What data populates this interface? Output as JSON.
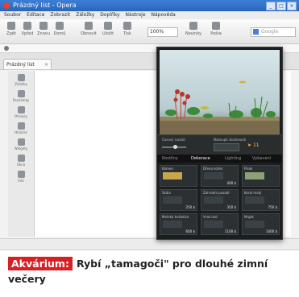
{
  "window": {
    "title": "Prázdný list - Opera"
  },
  "menu": [
    "Soubor",
    "Editace",
    "Zobrazit",
    "Záložky",
    "Doplňky",
    "Nástroje",
    "Nápověda"
  ],
  "toolbar": {
    "buttons": [
      "Zpět",
      "Vpřed",
      "Znovu",
      "Domů",
      "Obnovit",
      "Uložit",
      "Tisk"
    ],
    "zoom": "100%",
    "right_buttons": [
      "Novinky",
      "Pošta"
    ],
    "search_placeholder": "Google"
  },
  "tab": {
    "label": "Prázdný list"
  },
  "side_panel": [
    "Záložky",
    "Poznámky",
    "Přenosy",
    "Historie",
    "Widgety",
    "Okna",
    "Info"
  ],
  "aquarium_app": {
    "hud": {
      "label1": "Časový rozsah",
      "label2": "Nakoupit zkušenosti",
      "fish_count": "11"
    },
    "tabs": [
      "Rostliny",
      "Dekorace",
      "Lighting",
      "Vybavení"
    ],
    "active_tab": "Dekorace",
    "tiles": [
      {
        "name": "Kámen",
        "price": "",
        "color": "#c9a64b"
      },
      {
        "name": "Dřevo kořen",
        "price": "400 $",
        "color": "#3b4245"
      },
      {
        "name": "Písek",
        "price": "",
        "color": "#8da07a"
      },
      {
        "name": "Skála",
        "price": "250 $",
        "color": "#3b4245"
      },
      {
        "name": "Zahradní pozadí",
        "price": "350 $",
        "color": "#3b4245"
      },
      {
        "name": "Koral malý",
        "price": "750 $",
        "color": "#3b4245"
      },
      {
        "name": "Mořská hvězdice",
        "price": "600 $",
        "color": "#3b4245"
      },
      {
        "name": "Vrak lodi",
        "price": "1100 $",
        "color": "#3b4245"
      },
      {
        "name": "Maják",
        "price": "1400 $",
        "color": "#3b4245"
      }
    ]
  },
  "caption": {
    "badge": "Akvárium:",
    "text": "Rybí „tamagoči\" pro dlouhé zimní večery"
  }
}
